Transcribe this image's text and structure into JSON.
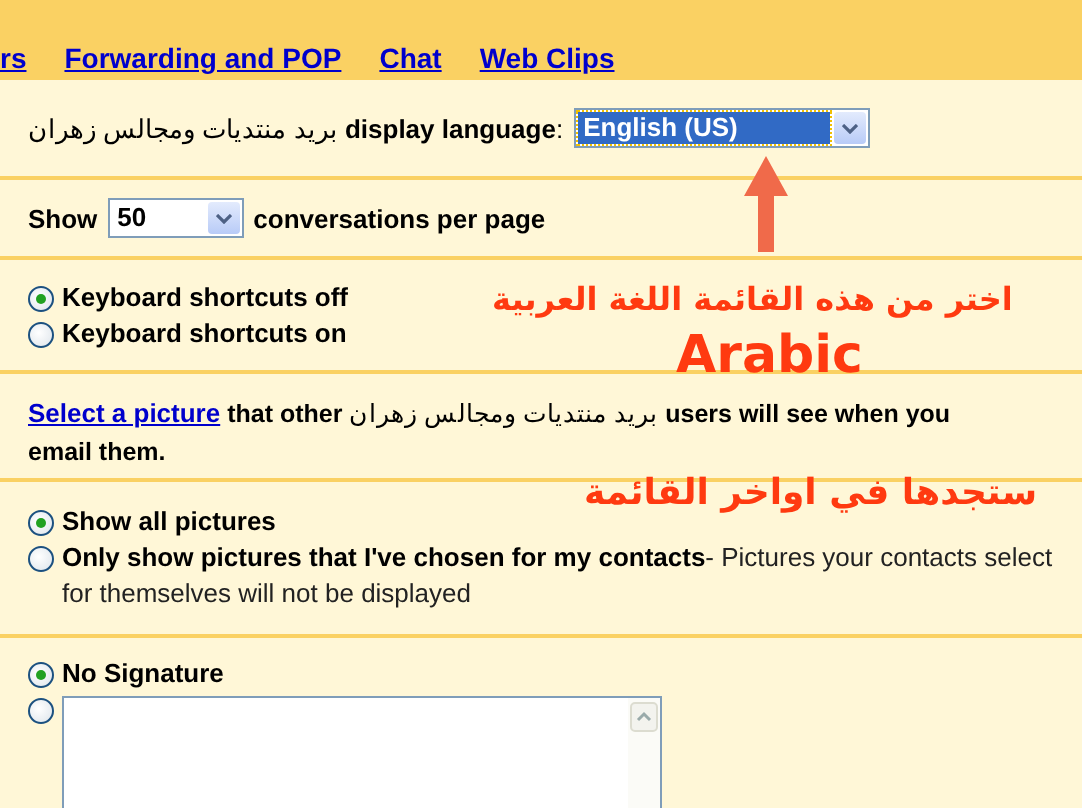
{
  "tabs": [
    {
      "label": "rs"
    },
    {
      "label": "Forwarding and POP"
    },
    {
      "label": "Chat"
    },
    {
      "label": "Web Clips"
    }
  ],
  "language": {
    "label": "بريد منتديات ومجالس زهران **display language**:",
    "value": "English (US)",
    "focused": true
  },
  "conversations": {
    "before": "Show",
    "value": "50",
    "after": "conversations per page"
  },
  "shortcuts": [
    {
      "label": "Keyboard shortcuts off",
      "selected": true
    },
    {
      "label": "Keyboard shortcuts on",
      "selected": false
    }
  ],
  "picture": {
    "link": "Select a picture",
    "text": "**that other** بريد منتديات ومجالس زهران **users will see when you email them.**"
  },
  "pictures": [
    {
      "label": "Show all pictures",
      "selected": true
    },
    {
      "label": "Only show pictures that I've chosen for my contacts",
      "note": "- Pictures your contacts select for themselves will not be displayed",
      "selected": false
    }
  ],
  "signature": {
    "options": [
      {
        "kind": "label",
        "label": "No Signature",
        "selected": true
      },
      {
        "kind": "field",
        "selected": false
      }
    ]
  },
  "annotation": {
    "line_1": "اختر من هذه القائمة اللغة العربية",
    "line_2": "Arabic",
    "line_3": "ستجدها في اواخر القائمة"
  }
}
